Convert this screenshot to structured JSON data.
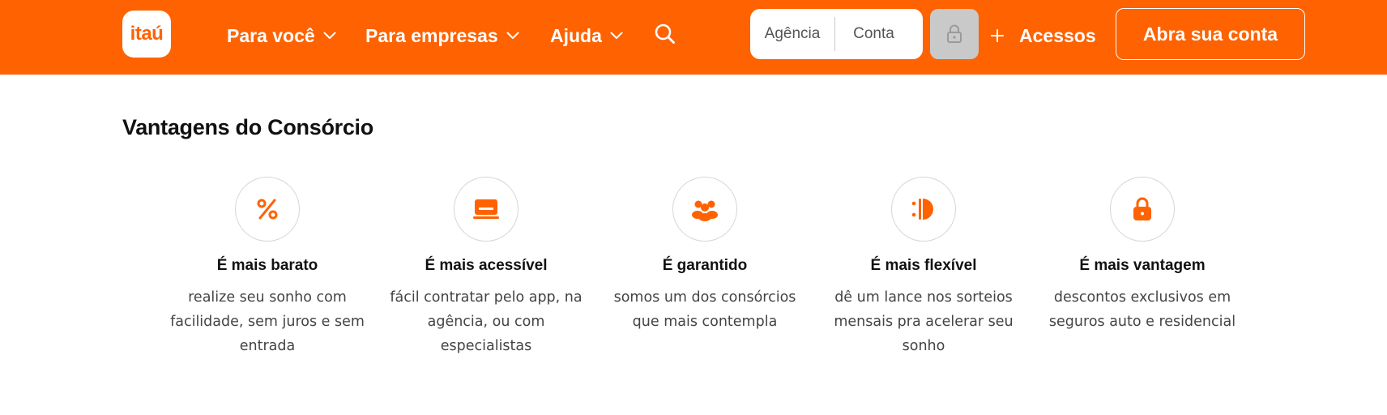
{
  "header": {
    "logo_text": "itaú",
    "nav": [
      {
        "label": "Para você"
      },
      {
        "label": "Para empresas"
      },
      {
        "label": "Ajuda"
      }
    ],
    "login": {
      "agencia_placeholder": "Agência",
      "conta_placeholder": "Conta"
    },
    "acessos_label": "Acessos",
    "open_account_label": "Abra sua conta"
  },
  "main": {
    "title": "Vantagens do Consórcio",
    "features": [
      {
        "icon": "percent-icon",
        "title": "É mais barato",
        "lines": [
          "realize seu sonho com",
          "facilidade, sem juros e sem",
          "entrada"
        ]
      },
      {
        "icon": "laptop-icon",
        "title": "É mais acessível",
        "lines": [
          "fácil contratar pelo app, na",
          "agência, ou com",
          "especialistas"
        ]
      },
      {
        "icon": "people-icon",
        "title": "É garantido",
        "lines": [
          "somos um dos consórcios",
          "que mais contempla"
        ]
      },
      {
        "icon": "flex-icon",
        "title": "É mais flexível",
        "lines": [
          "dê um lance nos sorteios",
          "mensais pra acelerar seu",
          "sonho"
        ]
      },
      {
        "icon": "lock-icon",
        "title": "É mais vantagem",
        "lines": [
          "descontos exclusivos em",
          "seguros auto e residencial"
        ]
      }
    ]
  },
  "colors": {
    "brand": "#ff6200",
    "lock_button_bg": "#c9c9c9"
  }
}
